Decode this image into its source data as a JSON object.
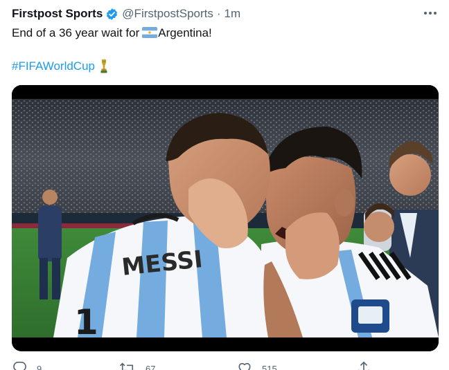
{
  "tweet": {
    "author_name": "Firstpost Sports",
    "handle": "@FirstpostSports",
    "separator": "·",
    "time": "1m",
    "text_before_flag": "End of a 36 year wait for",
    "text_after_flag": "Argentina!",
    "hashtag": "#FIFAWorldCup",
    "media": {
      "jersey_name": "MESSI"
    },
    "actions": {
      "reply_count": "9",
      "retweet_count": "67",
      "like_count": "515"
    }
  },
  "icons": {
    "verified": "verified-badge-icon",
    "more": "more-options-icon",
    "flag": "argentina-flag-icon",
    "trophy": "trophy-icon",
    "reply": "reply-icon",
    "retweet": "retweet-icon",
    "like": "heart-icon",
    "share": "share-icon"
  },
  "colors": {
    "link": "#1d9bf0",
    "secondary_text": "#536471",
    "primary_text": "#0f1419",
    "jersey_blue": "#74acdf"
  }
}
